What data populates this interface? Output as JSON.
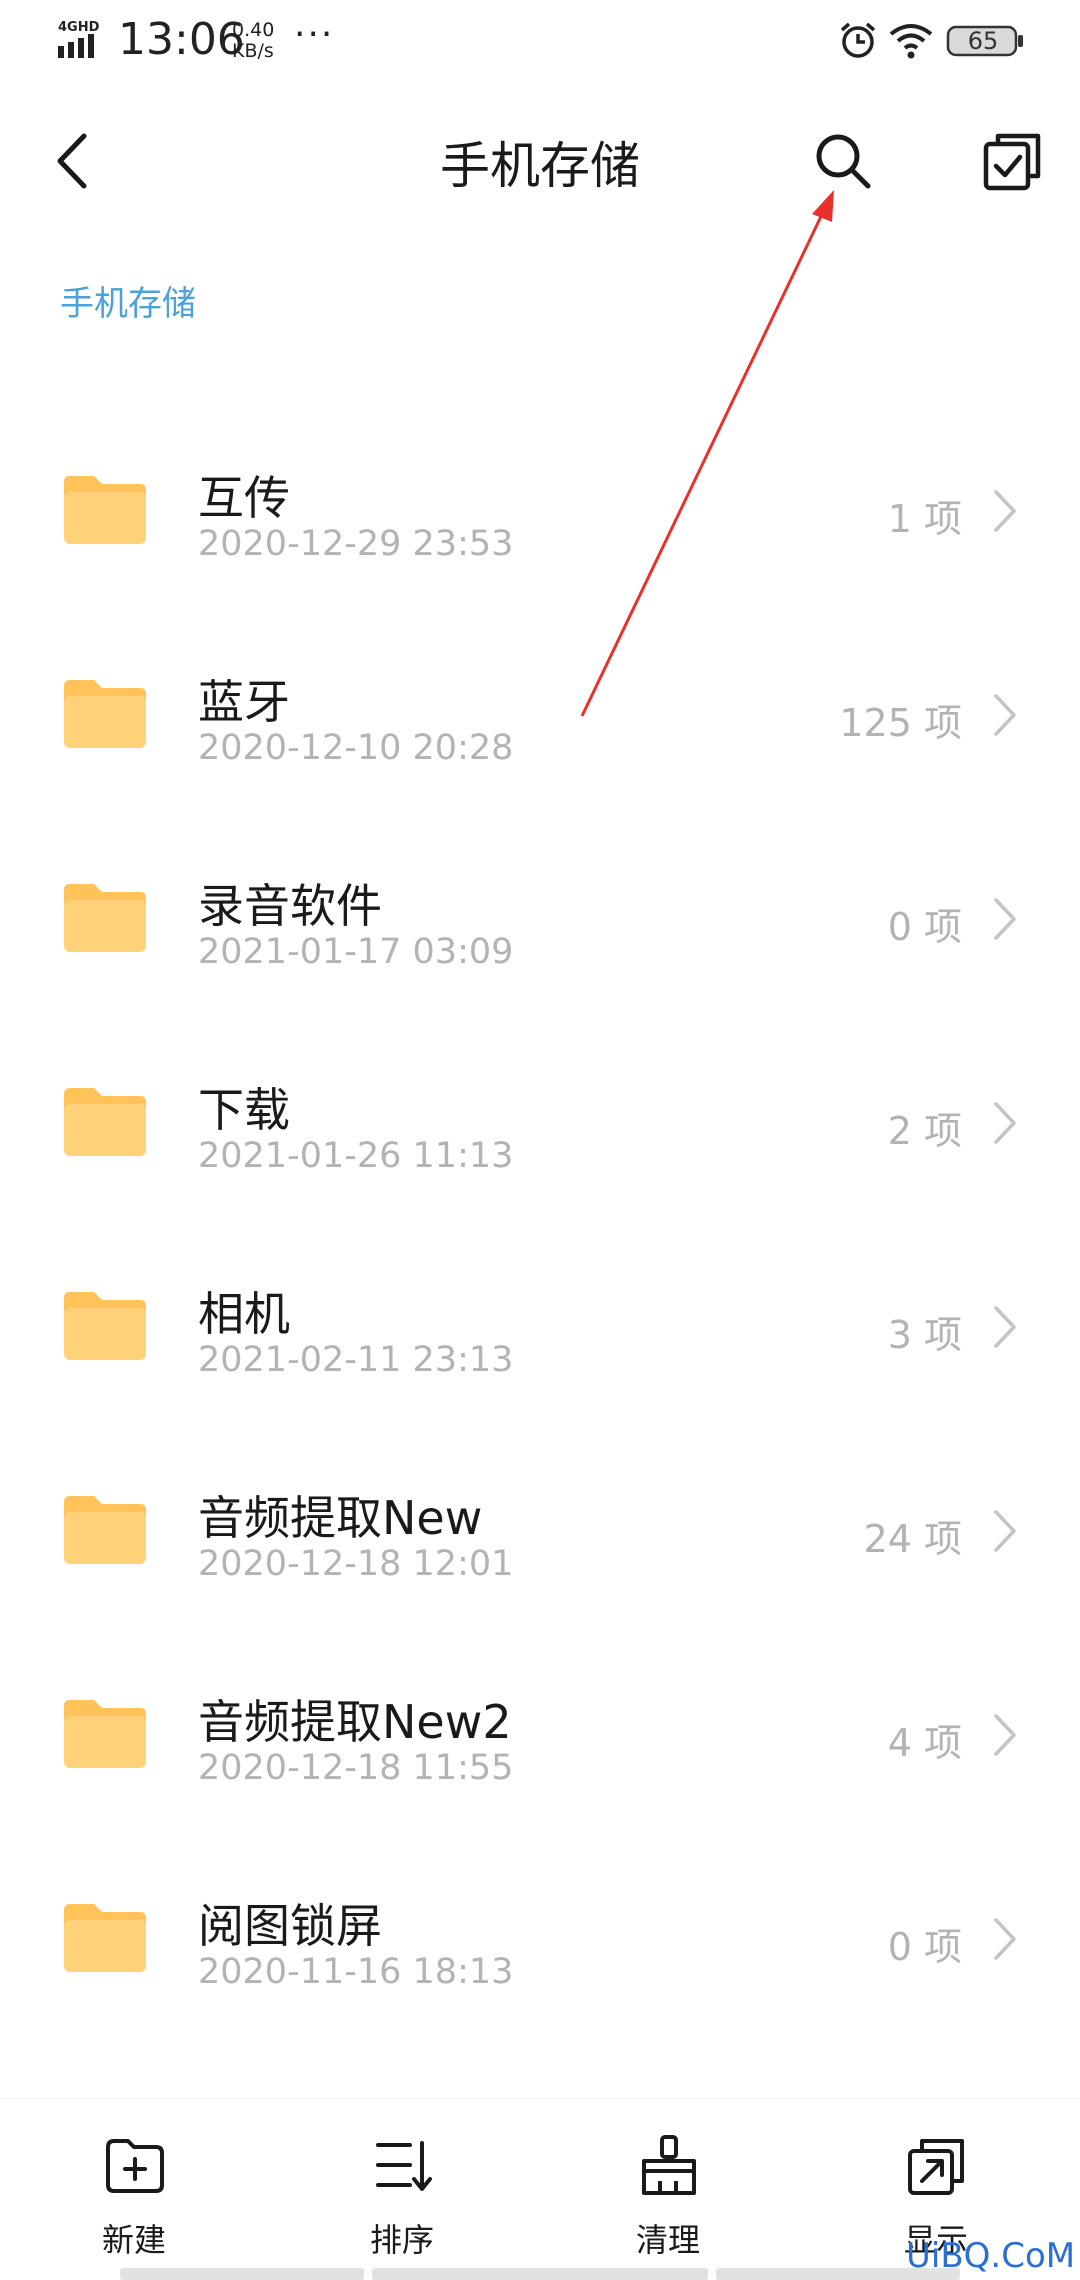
{
  "status_bar": {
    "network": "4GHD",
    "time": "13:06",
    "speed_value": "0.40",
    "speed_unit": "KB/s",
    "more": "···",
    "battery": "65",
    "icons": [
      "signal-icon",
      "alarm-icon",
      "wifi-icon",
      "battery-icon"
    ]
  },
  "header": {
    "title": "手机存储",
    "back_icon": "chevron-left-icon",
    "search_icon": "search-icon",
    "select_icon": "multi-select-icon"
  },
  "breadcrumb": "手机存储",
  "folders": [
    {
      "name": "互传",
      "date": "2020-12-29 23:53",
      "count": "1 项"
    },
    {
      "name": "蓝牙",
      "date": "2020-12-10 20:28",
      "count": "125 项"
    },
    {
      "name": "录音软件",
      "date": "2021-01-17 03:09",
      "count": "0 项"
    },
    {
      "name": "下载",
      "date": "2021-01-26 11:13",
      "count": "2 项"
    },
    {
      "name": "相机",
      "date": "2021-02-11 23:13",
      "count": "3 项"
    },
    {
      "name": "音频提取New",
      "date": "2020-12-18 12:01",
      "count": "24 项"
    },
    {
      "name": "音频提取New2",
      "date": "2020-12-18 11:55",
      "count": "4 项"
    },
    {
      "name": "阅图锁屏",
      "date": "2020-11-16 18:13",
      "count": "0 项"
    }
  ],
  "toolbar": {
    "new": "新建",
    "sort": "排序",
    "clean": "清理",
    "display": "显示"
  },
  "watermark": "UiBQ.CoM",
  "colors": {
    "accent": "#4aa2d8",
    "folder": "#ffd27a",
    "folder_tab": "#ffc35a",
    "secondary_text": "#b3b3b3",
    "annotation_arrow": "#e8312a"
  }
}
